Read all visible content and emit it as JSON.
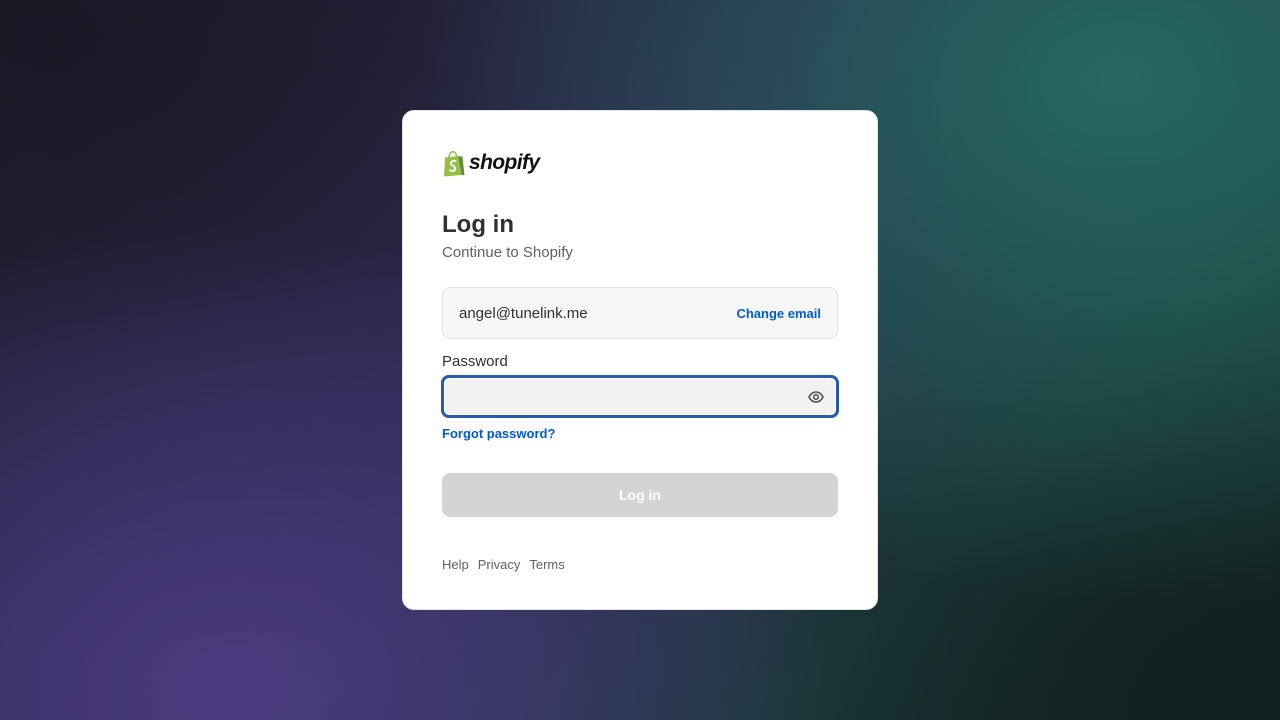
{
  "brand": {
    "name": "shopify",
    "logo_icon": "shopify-bag-icon",
    "bag_color": "#95bf47",
    "bag_shade": "#5e8e3e"
  },
  "login": {
    "title": "Log in",
    "subtitle": "Continue to Shopify"
  },
  "email": {
    "value": "angel@tunelink.me",
    "change_label": "Change email"
  },
  "password": {
    "label": "Password",
    "value": "",
    "toggle_icon": "eye-icon",
    "forgot_label": "Forgot password?"
  },
  "submit": {
    "label": "Log in",
    "disabled": true
  },
  "footer": {
    "help": "Help",
    "privacy": "Privacy",
    "terms": "Terms"
  },
  "colors": {
    "link": "#005bd3",
    "focus_ring": "#2a5aa8",
    "button_disabled": "#d4d4d4"
  }
}
